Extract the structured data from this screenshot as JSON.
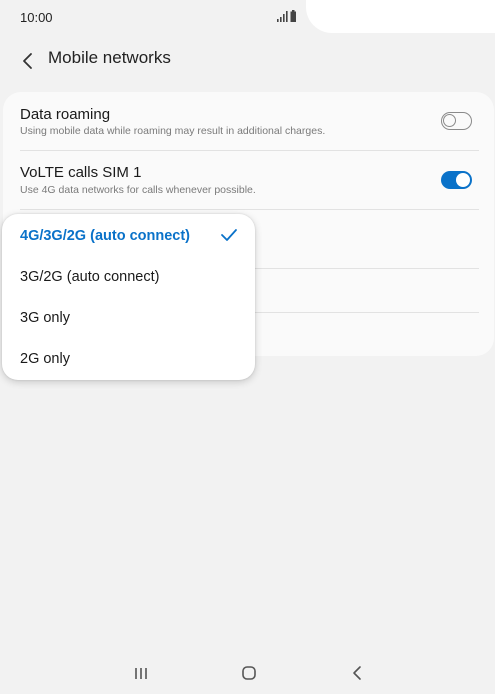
{
  "status_bar": {
    "time": "10:00",
    "icons": [
      "signal-icon",
      "battery-icon"
    ]
  },
  "header": {
    "back_icon": "back-arrow-icon",
    "title": "Mobile networks"
  },
  "settings": [
    {
      "title": "Data roaming",
      "subtitle": "Using mobile data while roaming may result in additional charges.",
      "toggle": "off"
    },
    {
      "title": "VoLTE calls SIM 1",
      "subtitle": "Use 4G data networks for calls whenever possible.",
      "toggle": "on"
    }
  ],
  "network_mode_menu": {
    "options": [
      "4G/3G/2G (auto connect)",
      "3G/2G (auto connect)",
      "3G only",
      "2G only"
    ],
    "selected": "4G/3G/2G (auto connect)"
  },
  "nav_bar": {
    "buttons": [
      "recent-apps-icon",
      "home-icon",
      "back-icon"
    ]
  },
  "colors": {
    "accent": "#0a72c9",
    "background": "#f2f2f2",
    "card": "#fafafa"
  }
}
